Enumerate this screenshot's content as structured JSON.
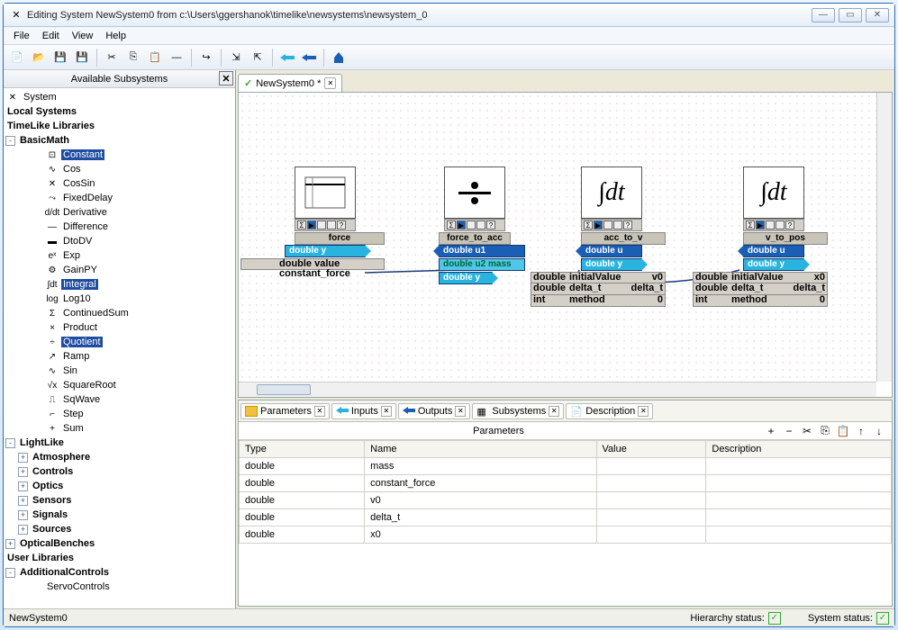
{
  "window": {
    "title": "Editing System NewSystem0 from c:\\Users\\ggershanok\\timelike\\newsystems\\newsystem_0"
  },
  "menu": {
    "file": "File",
    "edit": "Edit",
    "view": "View",
    "help": "Help"
  },
  "sidebar": {
    "header": "Available Subsystems",
    "root_system": "System",
    "local_systems": "Local Systems",
    "timelike_libraries": "TimeLike Libraries",
    "basicmath": "BasicMath",
    "items": [
      "Constant",
      "Cos",
      "CosSin",
      "FixedDelay",
      "Derivative",
      "Difference",
      "DtoDV",
      "Exp",
      "GainPY",
      "Integral",
      "Log10",
      "ContinuedSum",
      "Product",
      "Quotient",
      "Ramp",
      "Sin",
      "SquareRoot",
      "SqWave",
      "Step",
      "Sum"
    ],
    "icons": [
      "⊡",
      "∿",
      "✕",
      "⤳",
      "d/dt",
      "—",
      "▬",
      "eˣ",
      "⚙",
      "∫dt",
      "log",
      "Σ",
      "×",
      "÷",
      "↗",
      "∿",
      "√x",
      "⎍",
      "⌐",
      "+"
    ],
    "lightlike": "LightLike",
    "ll_items": [
      "Atmosphere",
      "Controls",
      "Optics",
      "Sensors",
      "Signals",
      "Sources"
    ],
    "optical_benches": "OpticalBenches",
    "user_libraries": "User Libraries",
    "additional_controls": "AdditionalControls",
    "servo": "ServoControls"
  },
  "tab": {
    "name": "NewSystem0 *"
  },
  "blocks": {
    "force": {
      "name": "force",
      "out": "double y",
      "param_label": "double value constant_force"
    },
    "force_to_acc": {
      "name": "force_to_acc",
      "in1": "double u1",
      "in2": "double u2 mass",
      "out": "double y"
    },
    "acc_to_v": {
      "name": "acc_to_v",
      "in": "double u",
      "out": "double y",
      "p1": [
        "double",
        "initialValue",
        "v0"
      ],
      "p2": [
        "double",
        "delta_t",
        "delta_t"
      ],
      "p3": [
        "int",
        "method",
        "0"
      ]
    },
    "v_to_pos": {
      "name": "v_to_pos",
      "in": "double u",
      "out": "double y",
      "p1": [
        "double",
        "initialValue",
        "x0"
      ],
      "p2": [
        "double",
        "delta_t",
        "delta_t"
      ],
      "p3": [
        "int",
        "method",
        "0"
      ]
    }
  },
  "bottom_tabs": {
    "parameters": "Parameters",
    "inputs": "Inputs",
    "outputs": "Outputs",
    "subsystems": "Subsystems",
    "description": "Description"
  },
  "parameters": {
    "title": "Parameters",
    "headers": [
      "Type",
      "Name",
      "Value",
      "Description"
    ],
    "rows": [
      [
        "double",
        "mass",
        "",
        ""
      ],
      [
        "double",
        "constant_force",
        "",
        ""
      ],
      [
        "double",
        "v0",
        "",
        ""
      ],
      [
        "double",
        "delta_t",
        "",
        ""
      ],
      [
        "double",
        "x0",
        "",
        ""
      ]
    ]
  },
  "status": {
    "left": "NewSystem0",
    "hierarchy": "Hierarchy status:",
    "system": "System status:"
  }
}
